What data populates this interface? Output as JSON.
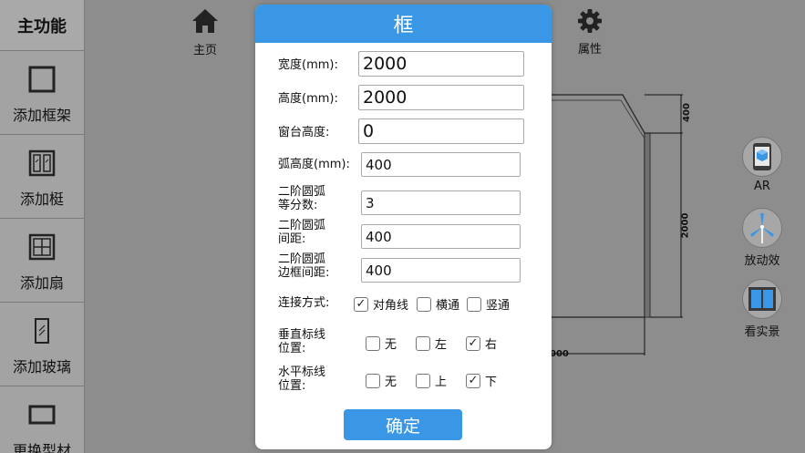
{
  "sidebar": {
    "title": "主功能",
    "items": [
      {
        "label": "添加框架",
        "icon": "frame-icon"
      },
      {
        "label": "添加梃",
        "icon": "mullion-icon"
      },
      {
        "label": "添加扇",
        "icon": "sash-icon"
      },
      {
        "label": "添加玻璃",
        "icon": "glass-icon"
      },
      {
        "label": "更换型材",
        "icon": "profile-icon"
      }
    ]
  },
  "toolbar": {
    "home_label": "主页",
    "properties_label": "属性"
  },
  "right_tools": {
    "ar_label": "AR",
    "animation_label": "放动效",
    "realview_label": "看实景"
  },
  "drawing": {
    "dim_top": "400",
    "dim_right": "2000",
    "dim_bottom": "000"
  },
  "dialog": {
    "title": "框",
    "fields": {
      "width": {
        "label": "宽度(mm):",
        "value": "2000"
      },
      "height": {
        "label": "高度(mm):",
        "value": "2000"
      },
      "sill_height": {
        "label": "窗台高度:",
        "value": "0"
      },
      "arc_height": {
        "label": "弧高度(mm):",
        "value": "400"
      },
      "arc2_divisions": {
        "label_line1": "二阶圆弧",
        "label_line2": "等分数:",
        "value": "3"
      },
      "arc2_spacing": {
        "label_line1": "二阶圆弧",
        "label_line2": "间距:",
        "value": "400"
      },
      "arc2_edge_spacing": {
        "label_line1": "二阶圆弧",
        "label_line2": "边框间距:",
        "value": "400"
      }
    },
    "connection": {
      "label": "连接方式:",
      "options": [
        {
          "label": "对角线",
          "checked": true
        },
        {
          "label": "横通",
          "checked": false
        },
        {
          "label": "竖通",
          "checked": false
        }
      ]
    },
    "vertical_dim": {
      "label_line1": "垂直标线",
      "label_line2": "位置:",
      "options": [
        {
          "label": "无",
          "checked": false
        },
        {
          "label": "左",
          "checked": false
        },
        {
          "label": "右",
          "checked": true
        }
      ]
    },
    "horizontal_dim": {
      "label_line1": "水平标线",
      "label_line2": "位置:",
      "options": [
        {
          "label": "无",
          "checked": false
        },
        {
          "label": "上",
          "checked": false
        },
        {
          "label": "下",
          "checked": true
        }
      ]
    },
    "confirm_label": "确定",
    "check_mark": "✓"
  },
  "colors": {
    "accent": "#3a97e6",
    "sidebar_bg": "#a3a3a3",
    "canvas_bg": "#8d8d8d"
  }
}
